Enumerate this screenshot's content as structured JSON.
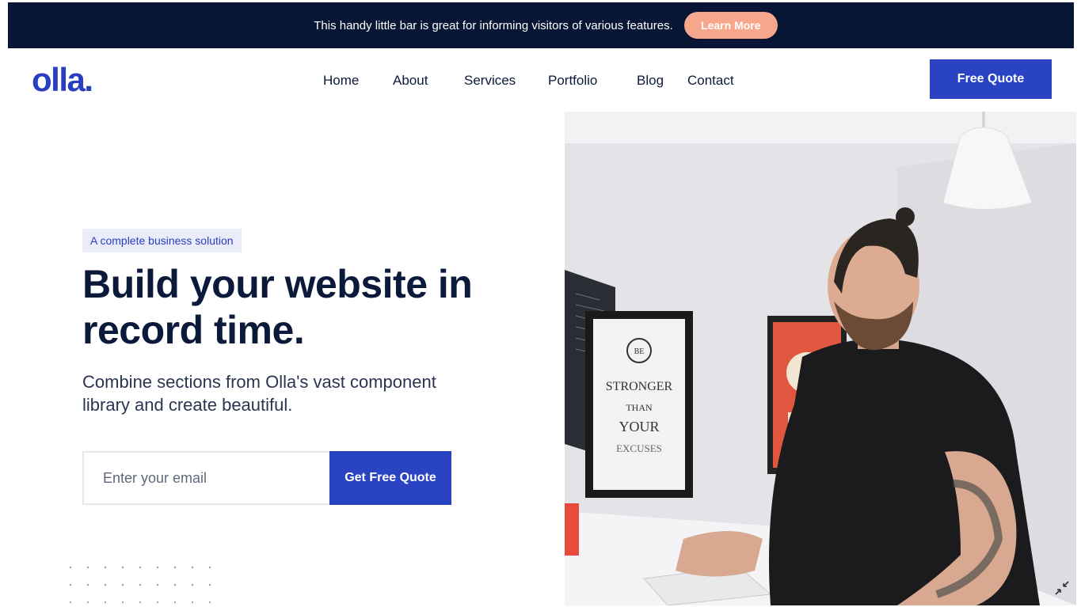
{
  "announcement": {
    "text": "This handy little bar is great for informing visitors of various features.",
    "button_label": "Learn More"
  },
  "header": {
    "logo": "olla.",
    "nav": [
      {
        "label": "Home"
      },
      {
        "label": "About"
      },
      {
        "label": "Services"
      },
      {
        "label": "Portfolio"
      },
      {
        "label": "Blog"
      },
      {
        "label": "Contact"
      }
    ],
    "cta_label": "Free Quote"
  },
  "hero": {
    "badge": "A complete business solution",
    "title": "Build your website in record time.",
    "subtitle": "Combine sections from Olla's vast component library and create beautiful.",
    "email_placeholder": "Enter your email",
    "submit_label": "Get Free Quote"
  },
  "poster": {
    "line1": "STRONGER",
    "line2": "THAN",
    "line3": "YOUR",
    "line4": "EXCUSES"
  },
  "colors": {
    "topbar_bg": "#061634",
    "brand_blue": "#2a43c2",
    "learn_more_bg": "#f9a78c",
    "title_text": "#0b1a3a"
  },
  "icons": {
    "photo_corner": "shrink-icon"
  }
}
